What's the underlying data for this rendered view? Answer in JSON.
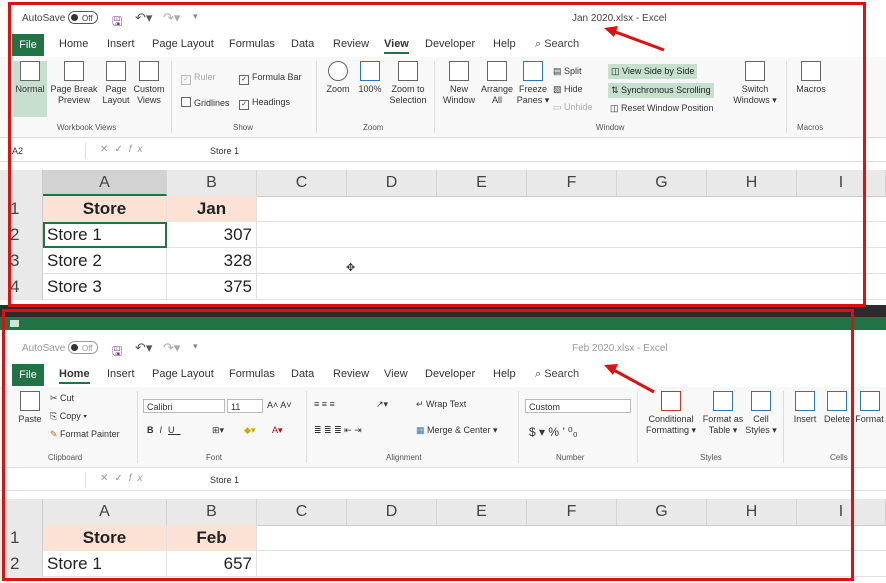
{
  "window1": {
    "autosave_label": "AutoSave",
    "autosave_state": "Off",
    "doc_title": "Jan 2020.xlsx  -  Excel",
    "tabs": [
      "File",
      "Home",
      "Insert",
      "Page Layout",
      "Formulas",
      "Data",
      "Review",
      "View",
      "Developer",
      "Help"
    ],
    "active_tab": "View",
    "search_label": "Search",
    "ribbon": {
      "workbook_views": {
        "normal": "Normal",
        "page_break": "Page Break Preview",
        "page_layout": "Page Layout",
        "custom_views": "Custom Views",
        "label": "Workbook Views"
      },
      "show": {
        "ruler": "Ruler",
        "formula_bar": "Formula Bar",
        "gridlines": "Gridlines",
        "headings": "Headings",
        "label": "Show"
      },
      "zoom": {
        "zoom": "Zoom",
        "zoom100": "100%",
        "zoom_sel": "Zoom to Selection",
        "label": "Zoom"
      },
      "window": {
        "new_window": "New Window",
        "arrange_all": "Arrange All",
        "freeze_panes": "Freeze Panes ▾",
        "split": "Split",
        "hide": "Hide",
        "unhide": "Unhide",
        "side_by_side": "View Side by Side",
        "sync_scroll": "Synchronous Scrolling",
        "reset_pos": "Reset Window Position",
        "switch": "Switch Windows ▾",
        "label": "Window"
      },
      "macros": {
        "macros": "Macros",
        "label": "Macros"
      }
    },
    "name_box": "A2",
    "formula": "Store 1",
    "columns": [
      "A",
      "B",
      "C",
      "D",
      "E",
      "F",
      "G",
      "H",
      "I"
    ],
    "rows": [
      {
        "n": "1",
        "a": "Store",
        "b": "Jan"
      },
      {
        "n": "2",
        "a": "Store 1",
        "b": "307"
      },
      {
        "n": "3",
        "a": "Store 2",
        "b": "328"
      },
      {
        "n": "4",
        "a": "Store 3",
        "b": "375"
      }
    ]
  },
  "window2": {
    "autosave_label": "AutoSave",
    "autosave_state": "Off",
    "doc_title": "Feb 2020.xlsx  -  Excel",
    "tabs": [
      "File",
      "Home",
      "Insert",
      "Page Layout",
      "Formulas",
      "Data",
      "Review",
      "View",
      "Developer",
      "Help"
    ],
    "active_tab": "Home",
    "search_label": "Search",
    "ribbon": {
      "clipboard": {
        "paste": "Paste",
        "cut": "Cut",
        "copy": "Copy ▾",
        "format_painter": "Format Painter",
        "label": "Clipboard"
      },
      "font": {
        "name": "Calibri",
        "size": "11",
        "label": "Font"
      },
      "alignment": {
        "wrap": "Wrap Text",
        "merge": "Merge & Center ▾",
        "label": "Alignment"
      },
      "number": {
        "format": "Custom",
        "label": "Number"
      },
      "styles": {
        "conditional": "Conditional Formatting ▾",
        "format_table": "Format as Table ▾",
        "cell_styles": "Cell Styles ▾",
        "label": "Styles"
      },
      "cells": {
        "insert": "Insert",
        "delete": "Delete",
        "format": "Format",
        "label": "Cells"
      }
    },
    "name_box": "",
    "formula": "Store 1",
    "columns": [
      "A",
      "B",
      "C",
      "D",
      "E",
      "F",
      "G",
      "H",
      "I"
    ],
    "rows": [
      {
        "n": "1",
        "a": "Store",
        "b": "Feb"
      },
      {
        "n": "2",
        "a": "Store 1",
        "b": "657"
      }
    ]
  },
  "colors": {
    "excel_green": "#217346",
    "header_fill": "#fbe2d5",
    "highlight": "#c6dfcf",
    "annotation_red": "#e01010"
  }
}
